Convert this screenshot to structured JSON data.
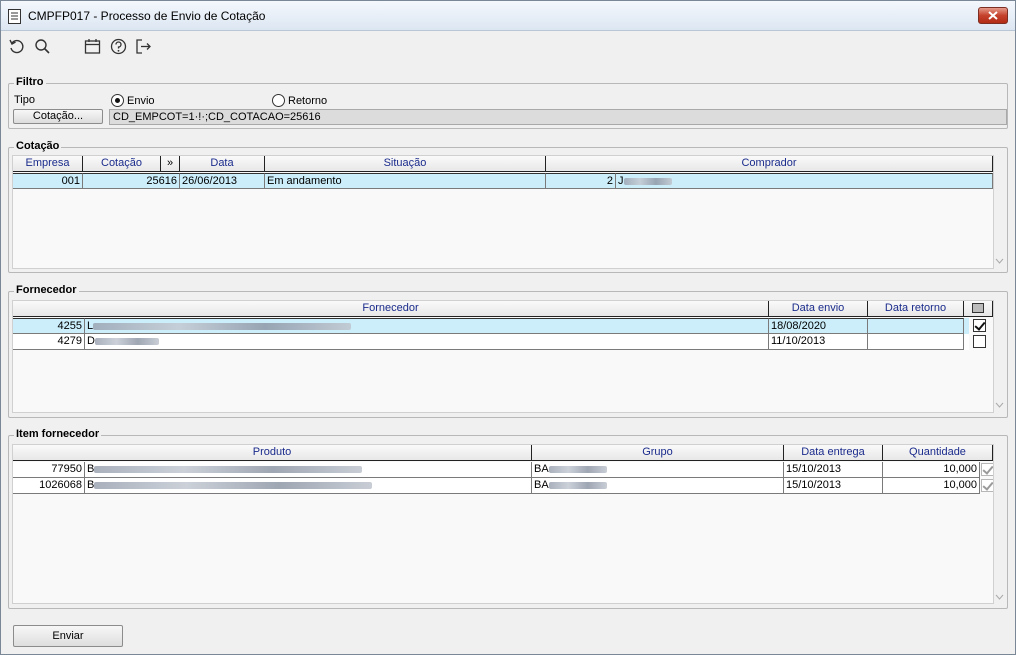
{
  "window": {
    "title": "CMPFP017 - Processo de Envio de Cotação"
  },
  "toolbar": {
    "icons": [
      "refresh-icon",
      "search-icon",
      "calendar-icon",
      "help-icon",
      "exit-icon"
    ]
  },
  "filtro": {
    "legend": "Filtro",
    "tipo_label": "Tipo",
    "radio_envio": "Envio",
    "radio_retorno": "Retorno",
    "selected": "Envio",
    "cotacao_button": "Cotação...",
    "cotacao_value": "CD_EMPCOT=1·!·;CD_COTACAO=25616"
  },
  "cotacao": {
    "legend": "Cotação",
    "columns": [
      "Empresa",
      "Cotação",
      "»",
      "Data",
      "Situação",
      "Comprador"
    ],
    "rows": [
      {
        "empresa": "001",
        "cotacao": "25616",
        "data": "26/06/2013",
        "situacao": "Em andamento",
        "comprador_code": "2",
        "comprador_name": "J"
      }
    ]
  },
  "fornecedor": {
    "legend": "Fornecedor",
    "columns": [
      "Fornecedor",
      "Data envio",
      "Data retorno"
    ],
    "rows": [
      {
        "codigo": "4255",
        "nome": "L",
        "data_envio": "18/08/2020",
        "data_retorno": "",
        "checked": true
      },
      {
        "codigo": "4279",
        "nome": "D",
        "data_envio": "11/10/2013",
        "data_retorno": "",
        "checked": false
      }
    ]
  },
  "item_fornecedor": {
    "legend": "Item fornecedor",
    "columns": [
      "Produto",
      "Grupo",
      "Data entrega",
      "Quantidade"
    ],
    "rows": [
      {
        "codigo": "77950",
        "produto": "B",
        "grupo": "BA",
        "data_entrega": "15/10/2013",
        "quantidade": "10,000"
      },
      {
        "codigo": "1026068",
        "produto": "B",
        "grupo": "BA",
        "data_entrega": "15/10/2013",
        "quantidade": "10,000"
      }
    ]
  },
  "footer": {
    "send_button": "Enviar"
  }
}
